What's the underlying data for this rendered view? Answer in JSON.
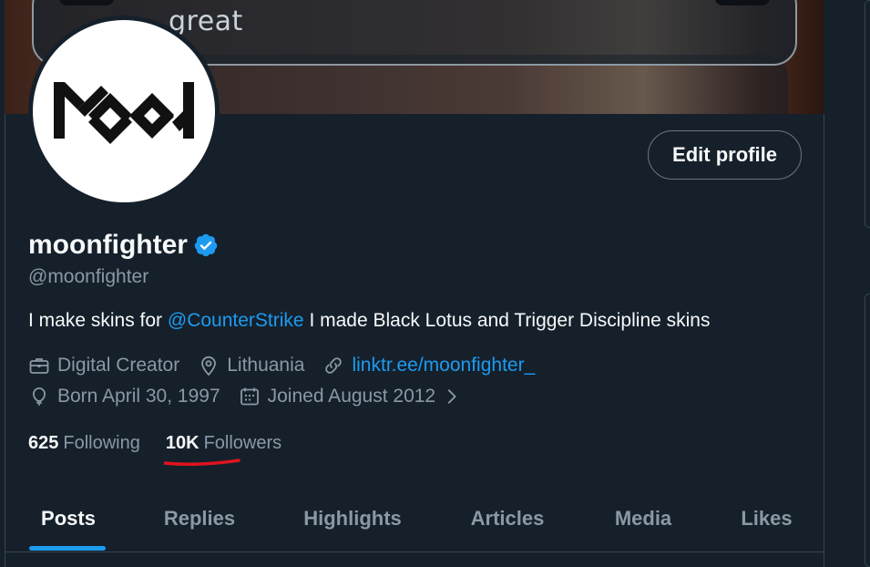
{
  "banner": {
    "visible_word": "great"
  },
  "profile": {
    "display_name": "moonfighter",
    "handle": "@moonfighter",
    "edit_button": "Edit profile",
    "bio": {
      "prefix": "I make skins for ",
      "mention": "@CounterStrike",
      "suffix": " I made Black Lotus and Trigger Discipline skins"
    },
    "meta": {
      "category": "Digital Creator",
      "location": "Lithuania",
      "link": "linktr.ee/moonfighter_",
      "birthday": "Born April 30, 1997",
      "joined": "Joined August 2012"
    },
    "stats": {
      "following_count": "625",
      "following_label": "Following",
      "followers_count": "10K",
      "followers_label": "Followers"
    }
  },
  "tabs": [
    "Posts",
    "Replies",
    "Highlights",
    "Articles",
    "Media",
    "Likes"
  ],
  "active_tab": "Posts",
  "colors": {
    "background": "#15202b",
    "accent": "#1d9bf0",
    "secondary_text": "#8b98a5",
    "annotation": "#e0141e"
  },
  "icons": {
    "verified": "verified-badge-icon",
    "category": "briefcase-icon",
    "location": "location-pin-icon",
    "link": "link-icon",
    "birthday": "balloon-icon",
    "joined": "calendar-icon",
    "expand": "chevron-right-icon"
  }
}
